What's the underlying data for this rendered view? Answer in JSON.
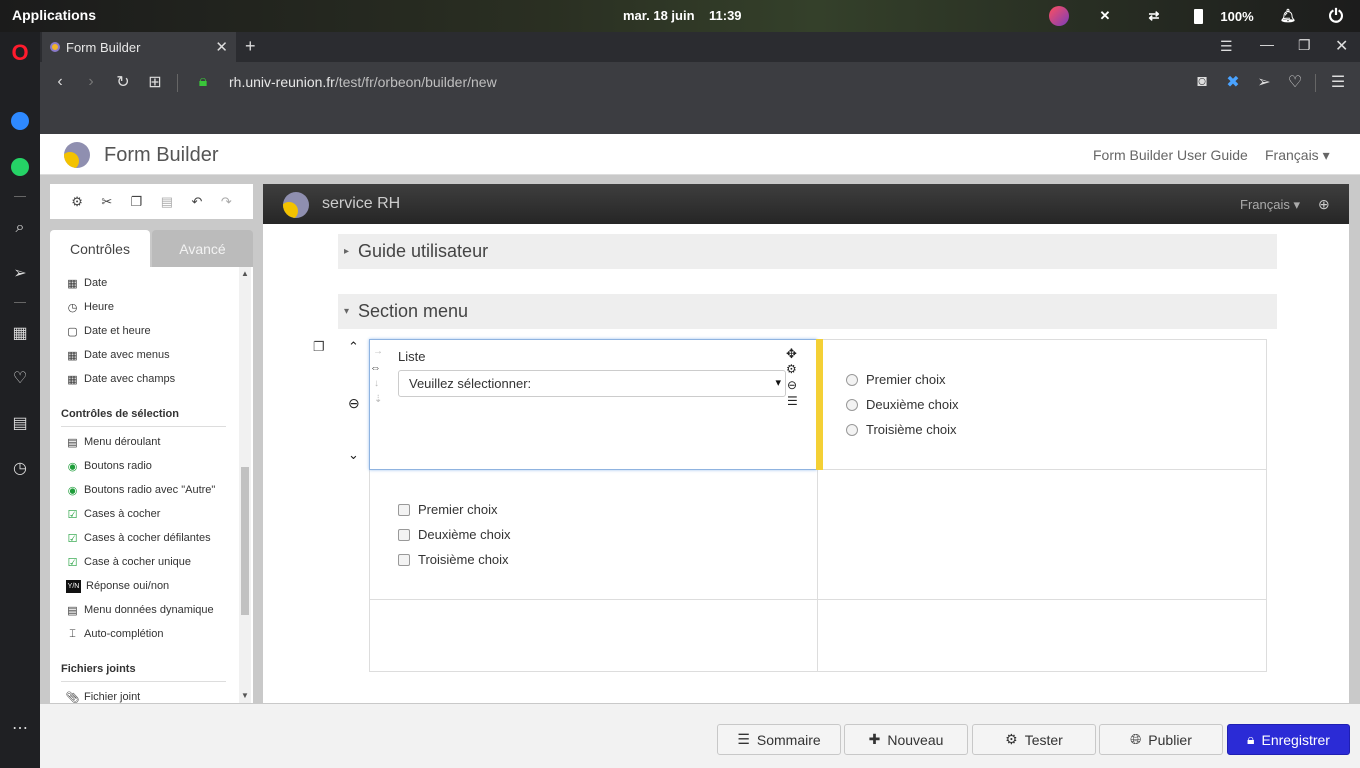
{
  "system": {
    "applications_label": "Applications",
    "date_label": "mar. 18 juin",
    "time_label": "11:39",
    "battery_label": "100%"
  },
  "browser": {
    "tab_title": "Form Builder",
    "url_host": "rh.univ-reunion.fr",
    "url_path": "/test/fr/orbeon/builder/new"
  },
  "app": {
    "title": "Form Builder",
    "guide_link": "Form Builder User Guide",
    "language": "Français ▾"
  },
  "toolbox": {
    "tab_controls": "Contrôles",
    "tab_advanced": "Avancé",
    "date_items": [
      "Date",
      "Heure",
      "Date et heure",
      "Date avec menus",
      "Date avec champs"
    ],
    "selection_heading": "Contrôles de sélection",
    "selection_items": [
      "Menu déroulant",
      "Boutons radio",
      "Boutons radio avec \"Autre\"",
      "Cases à cocher",
      "Cases à cocher défilantes",
      "Case à cocher unique",
      "Réponse oui/non",
      "Menu données dynamique",
      "Auto-complétion"
    ],
    "attachments_heading": "Fichiers joints",
    "attachment_items": [
      "Fichier joint"
    ]
  },
  "editor": {
    "form_name": "service RH",
    "language": "Français ▾",
    "sections": [
      "Guide utilisateur",
      "Section menu"
    ],
    "list_label": "Liste",
    "select_placeholder": "Veuillez sélectionner:",
    "radio_options": [
      "Premier choix",
      "Deuxième choix",
      "Troisième choix"
    ],
    "checkbox_options": [
      "Premier choix",
      "Deuxième choix",
      "Troisième choix"
    ]
  },
  "actions": {
    "summary": "Sommaire",
    "new": "Nouveau",
    "test": "Tester",
    "publish": "Publier",
    "save": "Enregistrer"
  },
  "colors": {
    "primary_button": "#2b2bd6",
    "selection_accent": "#f4d035"
  }
}
